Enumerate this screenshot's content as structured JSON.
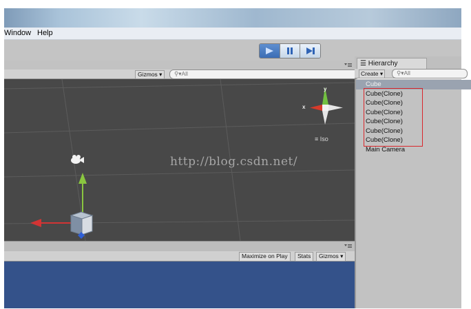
{
  "menu": {
    "items": [
      {
        "label": "Window"
      },
      {
        "label": "Help"
      }
    ]
  },
  "toolbar": {
    "play_icon": "play-icon",
    "pause_icon": "pause-icon",
    "step_icon": "step-icon"
  },
  "scene": {
    "gizmos_label": "Gizmos",
    "search_placeholder": "All",
    "iso_label": "Iso",
    "gizmo_axes": {
      "x": "x",
      "y": "y"
    },
    "watermark": "http://blog.csdn.net/"
  },
  "game": {
    "maximize_label": "Maximize on Play",
    "stats_label": "Stats",
    "gizmos_label": "Gizmos"
  },
  "hierarchy": {
    "tab_label": "Hierarchy",
    "create_label": "Create",
    "search_placeholder": "All",
    "items": [
      {
        "label": "Cube",
        "selected": true
      },
      {
        "label": "Cube(Clone)"
      },
      {
        "label": "Cube(Clone)"
      },
      {
        "label": "Cube(Clone)"
      },
      {
        "label": "Cube(Clone)"
      },
      {
        "label": "Cube(Clone)"
      },
      {
        "label": "Cube(Clone)"
      },
      {
        "label": "Main Camera"
      }
    ]
  },
  "colors": {
    "scene_bg": "#484848",
    "game_bg": "#34528a",
    "play_active": "#3b6db5",
    "highlight_box": "#d9252a"
  }
}
